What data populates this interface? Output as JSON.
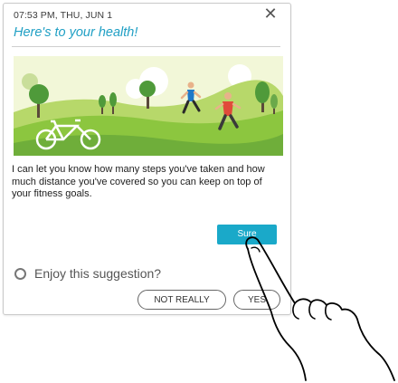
{
  "card": {
    "timestamp": "07:53 PM, THU, JUN 1",
    "title": "Here's to your health!",
    "close_icon": "close-icon",
    "illustration": "fitness-park-illustration",
    "body": "I can let you know how many steps you've taken and how much distance you've covered so you can keep on top of your fitness goals.",
    "primary_button": "Sure",
    "feedback": {
      "question": "Enjoy this suggestion?",
      "no_label": "NOT REALLY",
      "yes_label": "YES"
    }
  },
  "colors": {
    "accent": "#1aa9c9",
    "title": "#1f9fc4",
    "sky": "#f2f7d8",
    "grass": "#8cc63f",
    "dark_grass": "#4f9a3a"
  }
}
